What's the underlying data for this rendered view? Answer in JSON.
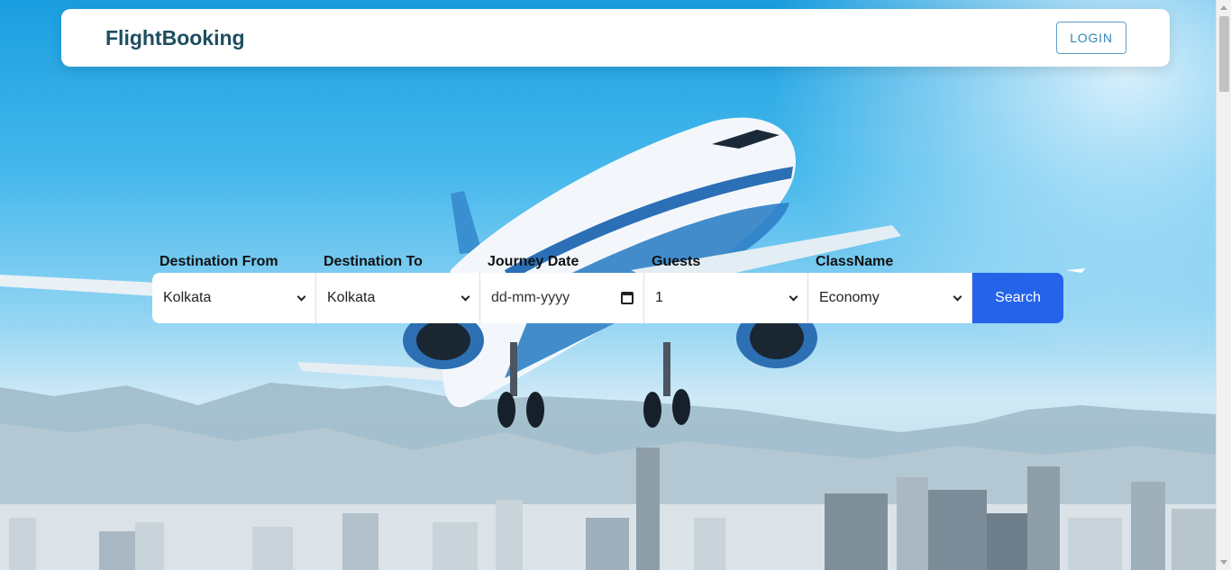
{
  "header": {
    "brand": "FlightBooking",
    "login_label": "LOGIN"
  },
  "search": {
    "from": {
      "label": "Destination From",
      "value": "Kolkata"
    },
    "to": {
      "label": "Destination To",
      "value": "Kolkata"
    },
    "date": {
      "label": "Journey Date",
      "placeholder": "dd-mm-yyyy"
    },
    "guests": {
      "label": "Guests",
      "value": "1"
    },
    "class": {
      "label": "ClassName",
      "value": "Economy"
    },
    "button_label": "Search"
  },
  "icons": {
    "select": "chevron-down-icon",
    "date": "calendar-icon"
  },
  "colors": {
    "brand_text": "#1d4e5f",
    "login_border": "#5aa0c8",
    "search_button": "#2563eb",
    "sky": "#45b8ec"
  }
}
